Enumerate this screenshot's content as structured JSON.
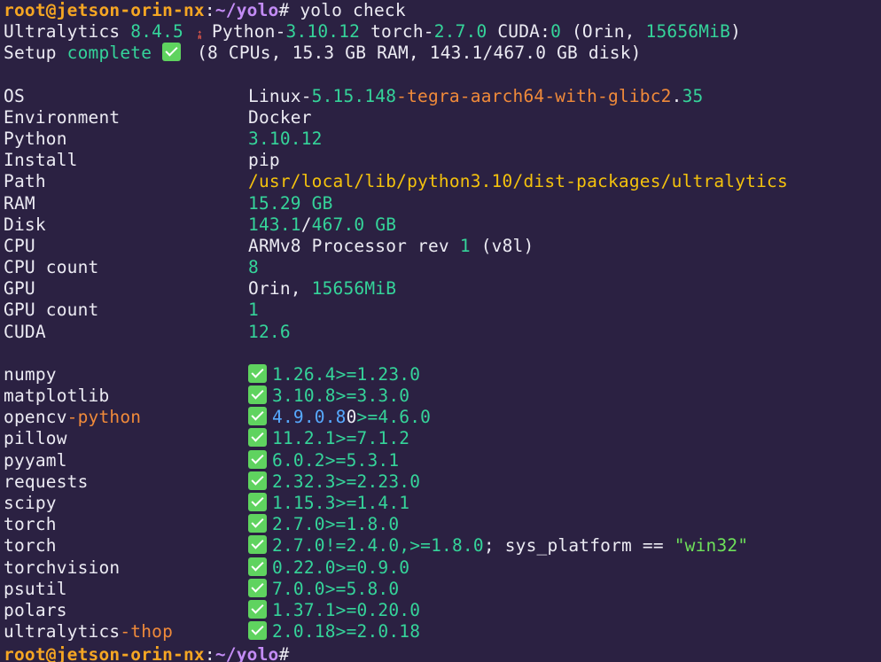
{
  "prompt": {
    "user_host": "root@jetson-orin-nx",
    "colon": ":",
    "path": "~/yolo",
    "hash": "#",
    "command": " yolo check"
  },
  "header": {
    "line1": {
      "a": "Ultralytics ",
      "ver": "8.4.5",
      "rocket": "🚀",
      "b": "Python-",
      "pyver": "3.10.12",
      "c": " torch-",
      "torchver": "2.7.0",
      "d": " CUDA:",
      "cudaidx": "0",
      "e": " (Orin, ",
      "mem": "15656MiB",
      "f": ")"
    },
    "line2": {
      "a": "Setup ",
      "complete": "complete",
      "b": " (",
      "cpus": "8",
      "c": " CPUs, ",
      "ram": "15.3",
      "d": " GB RAM, ",
      "disk_used": "143.1",
      "slash": "/",
      "disk_total": "467.0",
      "e": " GB disk)"
    }
  },
  "sysinfo": {
    "os": {
      "key": "OS",
      "a": "Linux-",
      "b": "5.15.148",
      "c": "-tegra-aarch64-with-glibc2",
      "d": ".",
      "e": "35"
    },
    "environment": {
      "key": "Environment",
      "val": "Docker"
    },
    "python": {
      "key": "Python",
      "val": "3.10.12"
    },
    "install": {
      "key": "Install",
      "val": "pip"
    },
    "path": {
      "key": "Path",
      "val": "/usr/local/lib/python3.10/dist-packages/ultralytics"
    },
    "ram": {
      "key": "RAM",
      "val": "15.29 GB"
    },
    "disk": {
      "key": "Disk",
      "a": "143.1",
      "b": "/",
      "c": "467.0 GB"
    },
    "cpu": {
      "key": "CPU",
      "a": "ARMv8 Processor rev ",
      "b": "1",
      "c": " (v8l)"
    },
    "cpu_count": {
      "key": "CPU count",
      "val": "8"
    },
    "gpu": {
      "key": "GPU",
      "a": "Orin, ",
      "b": "15656MiB"
    },
    "gpu_count": {
      "key": "GPU count",
      "val": "1"
    },
    "cuda": {
      "key": "CUDA",
      "val": "12.6"
    }
  },
  "packages": {
    "numpy": {
      "name": "numpy",
      "installed": "1.26.4",
      "req": ">=1.23.0"
    },
    "matplotlib": {
      "name": "matplotlib",
      "installed": "3.10.8",
      "req": ">=3.3.0"
    },
    "opencv": {
      "name_a": "opencv",
      "name_b": "-python",
      "v1": "4.9.0.8",
      "v2": "0",
      "req": ">=4.6.0"
    },
    "pillow": {
      "name": "pillow",
      "installed": "11.2.1",
      "req": ">=7.1.2"
    },
    "pyyaml": {
      "name": "pyyaml",
      "installed": "6.0.2",
      "req": ">=5.3.1"
    },
    "requests": {
      "name": "requests",
      "installed": "2.32.3",
      "req": ">=2.23.0"
    },
    "scipy": {
      "name": "scipy",
      "installed": "1.15.3",
      "req": ">=1.4.1"
    },
    "torch1": {
      "name": "torch",
      "installed": "2.7.0",
      "req": ">=1.8.0"
    },
    "torch2": {
      "name": "torch",
      "installed": "2.7.0",
      "req_a": "!=2.4.0,>=1.8.0",
      "req_b": "; sys_platform == ",
      "req_c": "\"win32\""
    },
    "torchvision": {
      "name": "torchvision",
      "installed": "0.22.0",
      "req": ">=0.9.0"
    },
    "psutil": {
      "name": "psutil",
      "installed": "7.0.0",
      "req": ">=5.8.0"
    },
    "polars": {
      "name": "polars",
      "installed": "1.37.1",
      "req": ">=0.20.0"
    },
    "thop": {
      "name_a": "ultralytics",
      "name_b": "-thop",
      "installed": "2.0.18",
      "req": ">=2.0.18"
    }
  },
  "final_prompt": {
    "user_host": "root@jetson-orin-nx",
    "colon": ":",
    "path": "~/yolo",
    "hash": "#"
  },
  "colors": {
    "background": "#2b2142",
    "text": "#ecebf3",
    "green": "#35d49a",
    "orange": "#f08a3a",
    "yellow": "#f4c20d",
    "blue": "#57a9ff",
    "prompt_user": "#f5a623",
    "prompt_path": "#c38cf5",
    "checkmark_bg": "#5fd35f"
  }
}
